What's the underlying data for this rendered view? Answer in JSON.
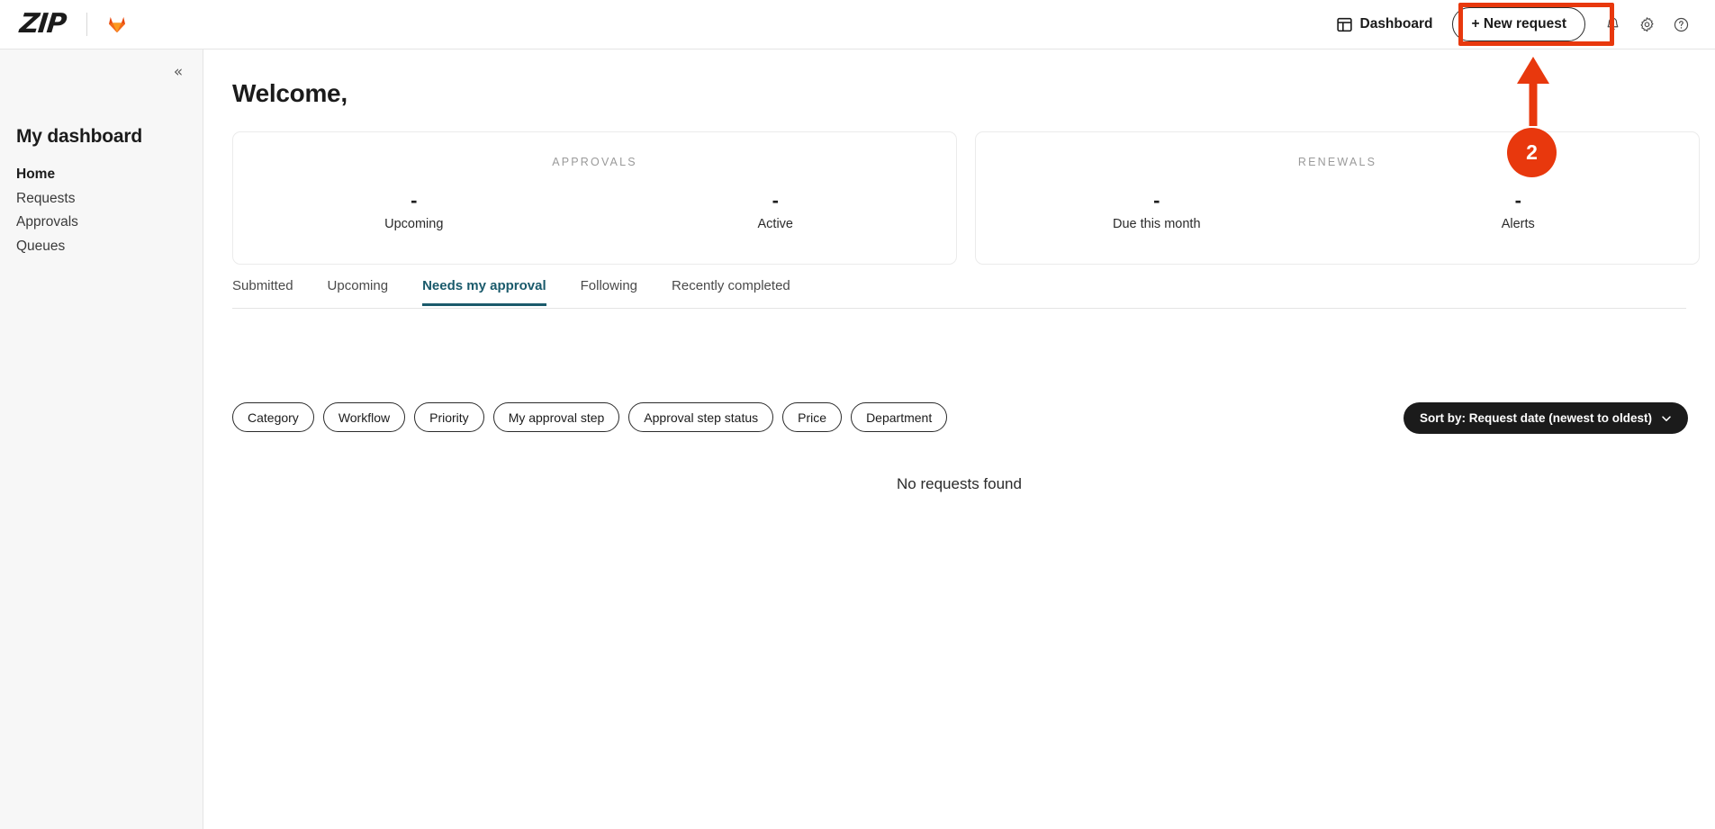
{
  "header": {
    "brand_logo": "zip-wordmark",
    "brand_logo_text": "ZIP",
    "secondary_logo": "fox-logo",
    "dashboard_label": "Dashboard",
    "dashboard_icon": "layout-panel-icon",
    "new_request_label": "+ New request",
    "notifications_icon": "bell-icon",
    "settings_icon": "gear-icon",
    "help_icon": "question-circle-icon"
  },
  "sidebar": {
    "collapse_icon": "chevron-double-left-icon",
    "collapse_glyph": "«",
    "title": "My dashboard",
    "items": [
      {
        "label": "Home",
        "active": true
      },
      {
        "label": "Requests",
        "active": false
      },
      {
        "label": "Approvals",
        "active": false
      },
      {
        "label": "Queues",
        "active": false
      }
    ]
  },
  "main": {
    "welcome": "Welcome,",
    "cards": [
      {
        "title": "APPROVALS",
        "metrics": [
          {
            "value": "-",
            "label": "Upcoming"
          },
          {
            "value": "-",
            "label": "Active"
          }
        ]
      },
      {
        "title": "RENEWALS",
        "metrics": [
          {
            "value": "-",
            "label": "Due this month"
          },
          {
            "value": "-",
            "label": "Alerts"
          }
        ]
      }
    ],
    "tabs": [
      {
        "label": "Submitted",
        "active": false
      },
      {
        "label": "Upcoming",
        "active": false
      },
      {
        "label": "Needs my approval",
        "active": true
      },
      {
        "label": "Following",
        "active": false
      },
      {
        "label": "Recently completed",
        "active": false
      }
    ],
    "filters": [
      {
        "label": "Category"
      },
      {
        "label": "Workflow"
      },
      {
        "label": "Priority"
      },
      {
        "label": "My approval step"
      },
      {
        "label": "Approval step status"
      },
      {
        "label": "Price"
      },
      {
        "label": "Department"
      }
    ],
    "sort": {
      "label": "Sort by: Request date (newest to oldest)",
      "chevron_icon": "chevron-down-icon"
    },
    "empty_state": "No requests found"
  },
  "annotation": {
    "step_number": "2",
    "color": "#e8380d",
    "target": "new-request-button"
  },
  "colors": {
    "accent_teal": "#1a5a6b",
    "annotation_red": "#e8380d",
    "sidebar_bg": "#f7f7f7",
    "text_primary": "#1b1b1b"
  }
}
